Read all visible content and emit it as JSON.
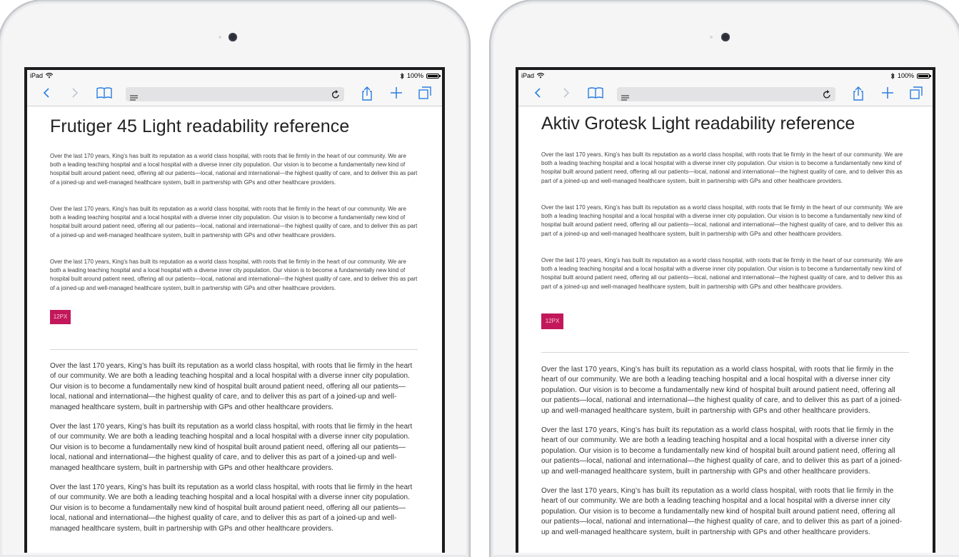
{
  "status_bar": {
    "device_label": "iPad",
    "battery_text": "100%",
    "icons": [
      "wifi-icon",
      "bluetooth-icon",
      "battery-icon"
    ]
  },
  "toolbar": {
    "icons": [
      "back-icon",
      "forward-icon",
      "bookmarks-icon",
      "reader-icon",
      "reload-icon",
      "share-icon",
      "add-icon",
      "tabs-icon"
    ]
  },
  "colors": {
    "badge": "#c2185b",
    "ipad_frame": "#f5f5f6",
    "toolbar_blue": "#2a7de1"
  },
  "pages": [
    {
      "title": "Frutiger 45 Light readability reference",
      "small_paragraphs": [
        "Over the last 170 years, King’s has built its reputation as a world class hospital, with roots that lie firmly in the heart of our community. We are both a leading teaching hospital and a local hospital with a diverse inner city population. Our vision is to become a fundamentally new kind of hospital built around patient need, offering all our patients—local, national and international—the highest quality of care, and to deliver this as part of a joined-up and well-managed healthcare system, built in partnership with GPs and other healthcare providers.",
        "Over the last 170 years, King’s has built its reputation as a world class hospital, with roots that lie firmly in the heart of our community. We are both a leading teaching hospital and a local hospital with a diverse inner city population. Our vision is to become a fundamentally new kind of hospital built around patient need, offering all our patients—local, national and international—the highest quality of care, and to deliver this as part of a joined-up and well-managed healthcare system, built in partnership with GPs and other healthcare providers.",
        "Over the last 170 years, King’s has built its reputation as a world class hospital, with roots that lie firmly in the heart of our community. We are both a leading teaching hospital and a local hospital with a diverse inner city population. Our vision is to become a fundamentally new kind of hospital built around patient need, offering all our patients—local, national and international—the highest quality of care, and to deliver this as part of a joined-up and well-managed healthcare system, built in partnership with GPs and other healthcare providers."
      ],
      "badge": "12PX",
      "large_paragraphs": [
        "Over the last 170 years, King’s has built its reputation as a world class hospital, with roots that lie firmly in the heart of our community. We are both a leading teaching hospital and a local hospital with a diverse inner city population. Our vision is to become a fundamentally new kind of hospital built around patient need, offering all our patients—local, national and international—the highest quality of care, and to deliver this as part of a joined-up and well-managed healthcare system, built in partnership with GPs and other healthcare providers.",
        "Over the last 170 years, King’s has built its reputation as a world class hospital, with roots that lie firmly in the heart of our community. We are both a leading teaching hospital and a local hospital with a diverse inner city population. Our vision is to become a fundamentally new kind of hospital built around patient need, offering all our patients—local, national and international—the highest quality of care, and to deliver this as part of a joined-up and well-managed healthcare system, built in partnership with GPs and other healthcare providers.",
        "Over the last 170 years, King’s has built its reputation as a world class hospital, with roots that lie firmly in the heart of our community. We are both a leading teaching hospital and a local hospital with a diverse inner city population. Our vision is to become a fundamentally new kind of hospital built around patient need, offering all our patients—local, national and international—the highest quality of care, and to deliver this as part of a joined-up and well-managed healthcare system, built in partnership with GPs and other healthcare providers."
      ]
    },
    {
      "title": "Aktiv Grotesk Light readability reference",
      "small_paragraphs": [
        "Over the last 170 years, King’s has built its reputation as a world class hospital, with roots that lie firmly in the heart of our community. We are both a leading teaching hospital and a local hospital with a diverse inner city population. Our vision is to become a fundamentally new kind of hospital built around patient need, offering all our patients—local, national and international—the highest quality of care, and to deliver this as part of a joined-up and well-managed healthcare system, built in partnership with GPs and other healthcare providers.",
        "Over the last 170 years, King’s has built its reputation as a world class hospital, with roots that lie firmly in the heart of our community. We are both a leading teaching hospital and a local hospital with a diverse inner city population. Our vision is to become a fundamentally new kind of hospital built around patient need, offering all our patients—local, national and international—the highest quality of care, and to deliver this as part of a joined-up and well-managed healthcare system, built in partnership with GPs and other healthcare providers.",
        "Over the last 170 years, King’s has built its reputation as a world class hospital, with roots that lie firmly in the heart of our community. We are both a leading teaching hospital and a local hospital with a diverse inner city population. Our vision is to become a fundamentally new kind of hospital built around patient need, offering all our patients—local, national and international—the highest quality of care, and to deliver this as part of a joined-up and well-managed healthcare system, built in partnership with GPs and other healthcare providers."
      ],
      "badge": "12PX",
      "large_paragraphs": [
        "Over the last 170 years, King’s has built its reputation as a world class hospital, with roots that lie firmly in the heart of our community. We are both a leading teaching hospital and a local hospital with a diverse inner city population. Our vision is to become a fundamentally new kind of hospital built around patient need, offering all our patients—local, national and international—the highest quality of care, and to deliver this as part of a joined-up and well-managed healthcare system, built in partnership with GPs and other healthcare providers.",
        "Over the last 170 years, King’s has built its reputation as a world class hospital, with roots that lie firmly in the heart of our community. We are both a leading teaching hospital and a local hospital with a diverse inner city population. Our vision is to become a fundamentally new kind of hospital built around patient need, offering all our patients—local, national and international—the highest quality of care, and to deliver this as part of a joined-up and well-managed healthcare system, built in partnership with GPs and other healthcare providers.",
        "Over the last 170 years, King’s has built its reputation as a world class hospital, with roots that lie firmly in the heart of our community. We are both a leading teaching hospital and a local hospital with a diverse inner city population. Our vision is to become a fundamentally new kind of hospital built around patient need, offering all our patients—local, national and international—the highest quality of care, and to deliver this as part of a joined-up and well-managed healthcare system, built in partnership with GPs and other healthcare providers."
      ]
    }
  ]
}
